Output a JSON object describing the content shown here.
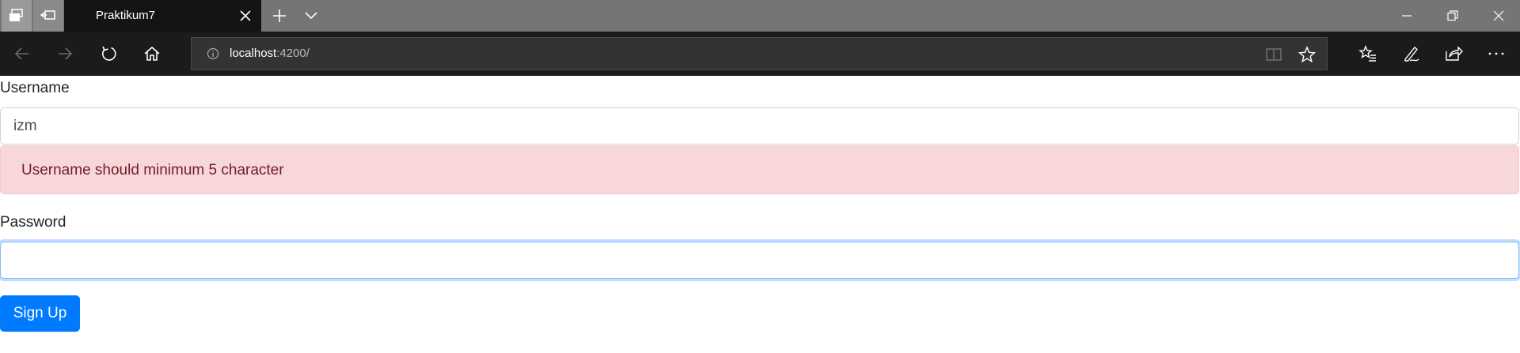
{
  "browser": {
    "tab": {
      "title": "Praktikum7"
    },
    "address": {
      "host": "localhost",
      "rest": ":4200/"
    },
    "icons": {
      "set_aside": "set-aside-tabs-icon",
      "tabs_preview": "tabs-preview-icon",
      "tab_close": "close-icon",
      "new_tab": "plus-icon",
      "tab_menu": "chevron-down-icon",
      "minimize": "minimize-icon",
      "maximize": "restore-icon",
      "close": "close-icon",
      "back": "arrow-left-icon",
      "forward": "arrow-right-icon",
      "refresh": "refresh-icon",
      "home": "home-icon",
      "site_info": "info-icon",
      "reading_view": "book-icon",
      "favorite": "star-icon",
      "favorites_hub": "favorites-list-icon",
      "web_notes": "pen-icon",
      "share": "share-icon",
      "more": "more-icon"
    }
  },
  "form": {
    "username": {
      "label": "Username",
      "value": "izm",
      "error": "Username should minimum 5 character"
    },
    "password": {
      "label": "Password",
      "value": ""
    },
    "submit_label": "Sign Up"
  },
  "colors": {
    "primary": "#007bff",
    "alert_bg": "#f8d7da",
    "alert_text": "#721c24",
    "focus_border": "#80bdff"
  }
}
